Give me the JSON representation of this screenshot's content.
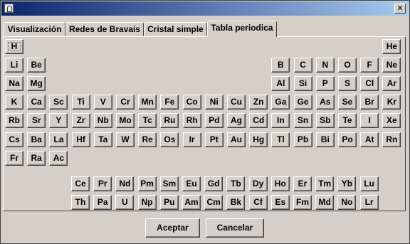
{
  "window": {
    "title": ""
  },
  "tabs": [
    {
      "label": "Visualización"
    },
    {
      "label": "Redes de Bravais"
    },
    {
      "label": "Cristal simple"
    },
    {
      "label": "Tabla periodica"
    }
  ],
  "elements": [
    [
      "H",
      "",
      "",
      "",
      "",
      "",
      "",
      "",
      "",
      "",
      "",
      "",
      "",
      "",
      "",
      "",
      "",
      "He"
    ],
    [
      "Li",
      "Be",
      "",
      "",
      "",
      "",
      "",
      "",
      "",
      "",
      "",
      "",
      "B",
      "C",
      "N",
      "O",
      "F",
      "Ne"
    ],
    [
      "Na",
      "Mg",
      "",
      "",
      "",
      "",
      "",
      "",
      "",
      "",
      "",
      "",
      "Al",
      "Si",
      "P",
      "S",
      "Cl",
      "Ar"
    ],
    [
      "K",
      "Ca",
      "Sc",
      "Ti",
      "V",
      "Cr",
      "Mn",
      "Fe",
      "Co",
      "Ni",
      "Cu",
      "Zn",
      "Ga",
      "Ge",
      "As",
      "Se",
      "Br",
      "Kr"
    ],
    [
      "Rb",
      "Sr",
      "Y",
      "Zr",
      "Nb",
      "Mo",
      "Tc",
      "Ru",
      "Rh",
      "Pd",
      "Ag",
      "Cd",
      "In",
      "Sn",
      "Sb",
      "Te",
      "I",
      "Xe"
    ],
    [
      "Cs",
      "Ba",
      "La",
      "Hf",
      "Ta",
      "W",
      "Re",
      "Os",
      "Ir",
      "Pt",
      "Au",
      "Hg",
      "Tl",
      "Pb",
      "Bi",
      "Po",
      "At",
      "Rn"
    ],
    [
      "Fr",
      "Ra",
      "Ac",
      "",
      "",
      "",
      "",
      "",
      "",
      "",
      "",
      "",
      "",
      "",
      "",
      "",
      "",
      ""
    ]
  ],
  "f_block": [
    [
      "Ce",
      "Pr",
      "Nd",
      "Pm",
      "Sm",
      "Eu",
      "Gd",
      "Tb",
      "Dy",
      "Ho",
      "Er",
      "Tm",
      "Yb",
      "Lu"
    ],
    [
      "Th",
      "Pa",
      "U",
      "Np",
      "Pu",
      "Am",
      "Cm",
      "Bk",
      "Cf",
      "Es",
      "Fm",
      "Md",
      "No",
      "Lr"
    ]
  ],
  "buttons": {
    "accept": "Aceptar",
    "cancel": "Cancelar"
  }
}
